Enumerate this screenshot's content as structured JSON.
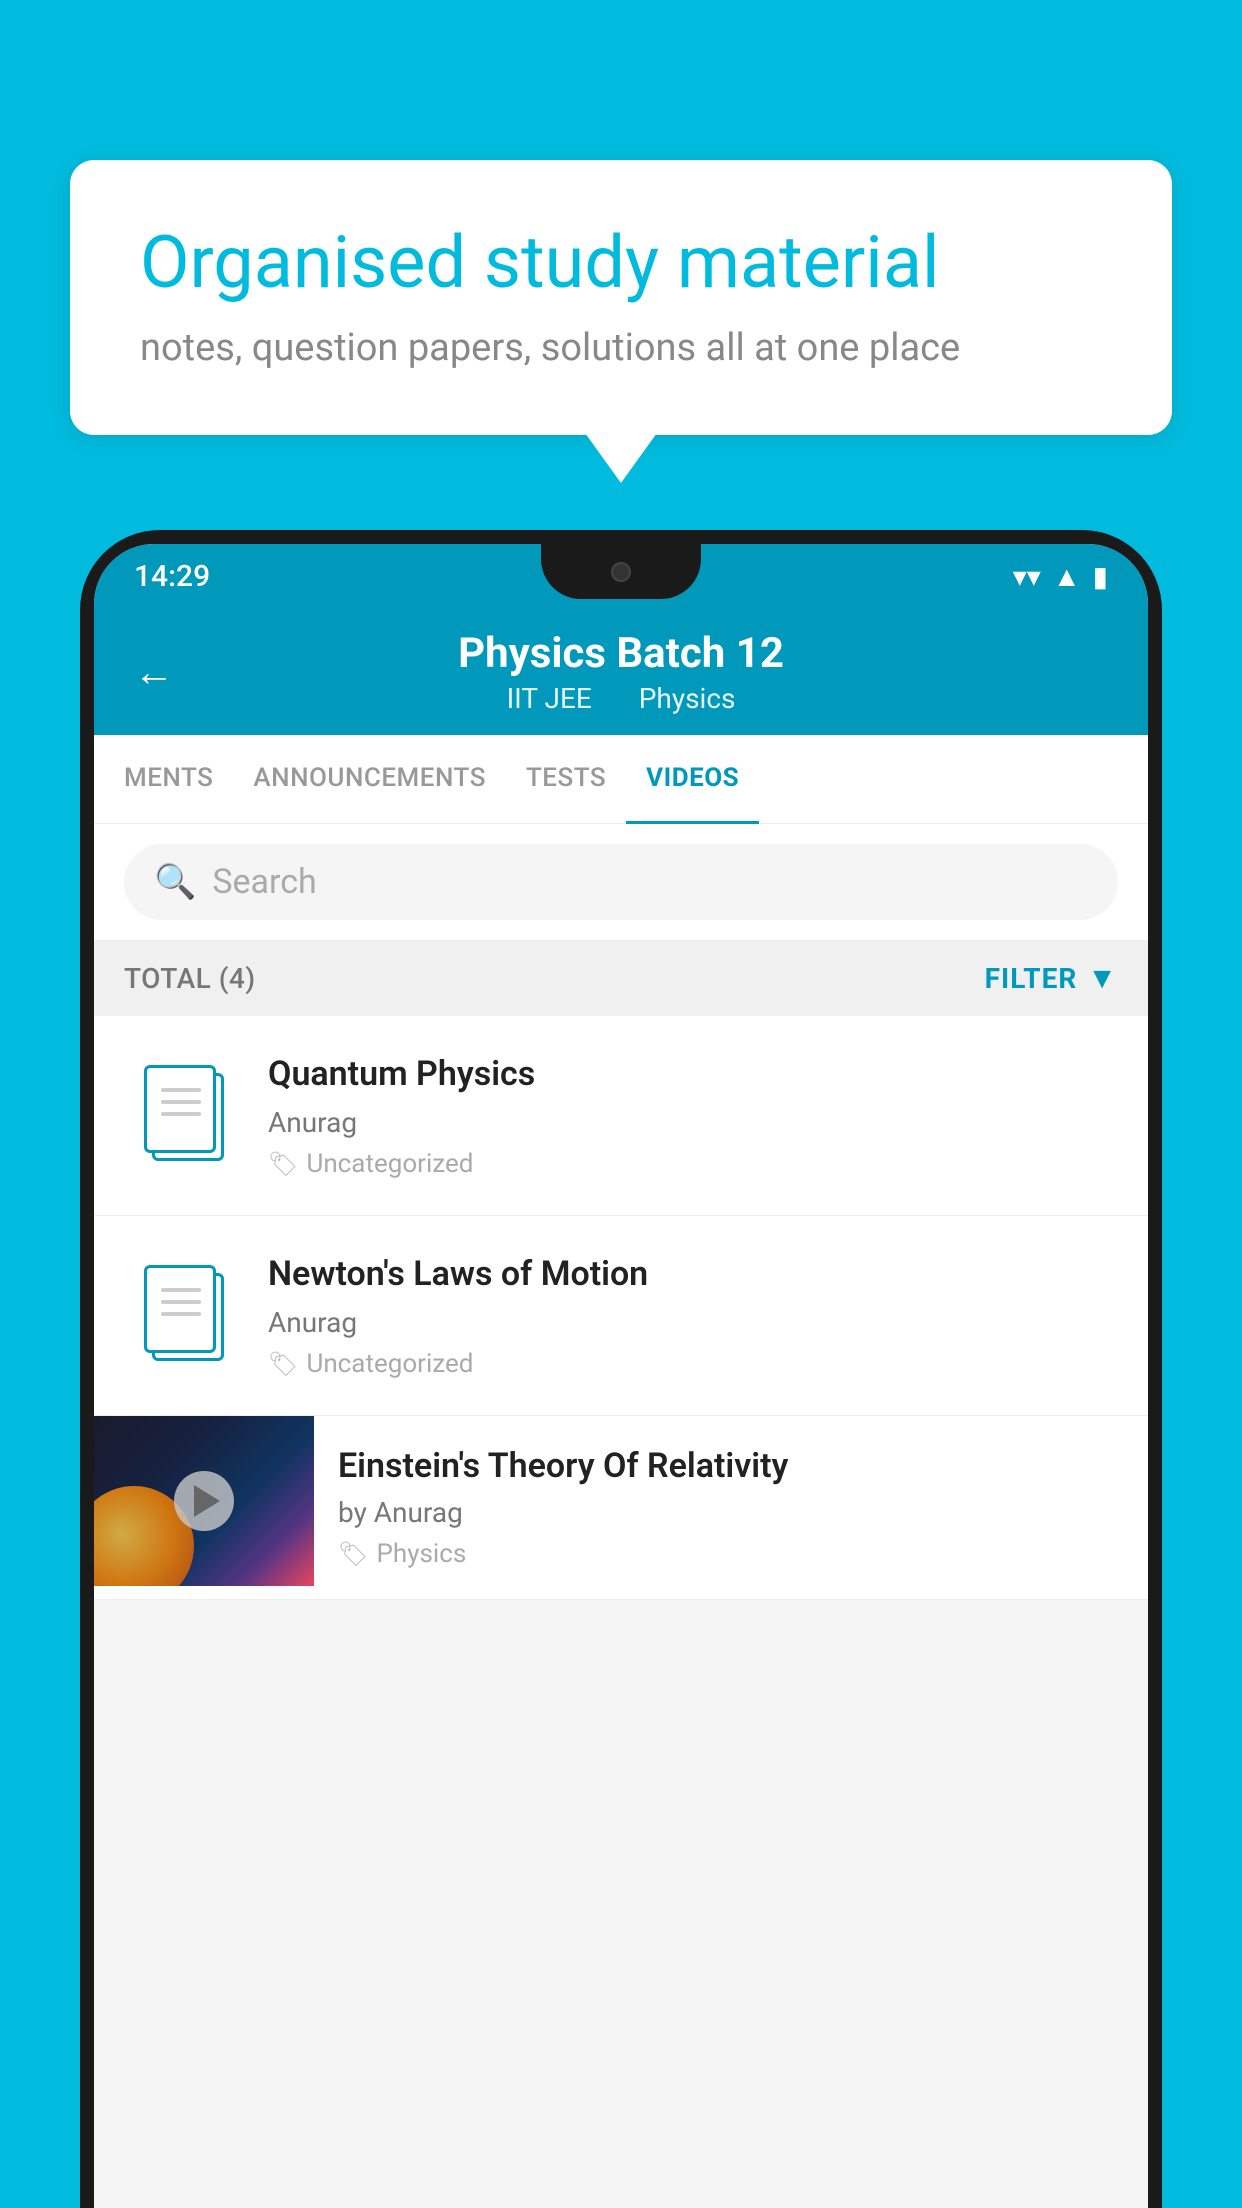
{
  "background_color": "#00BBDD",
  "speech_bubble": {
    "title": "Organised study material",
    "subtitle": "notes, question papers, solutions all at one place"
  },
  "phone": {
    "status_bar": {
      "time": "14:29",
      "icons": [
        "wifi",
        "signal",
        "battery"
      ]
    },
    "header": {
      "title": "Physics Batch 12",
      "subtitle_left": "IIT JEE",
      "subtitle_right": "Physics",
      "back_label": "←"
    },
    "tabs": [
      {
        "label": "MENTS",
        "active": false
      },
      {
        "label": "ANNOUNCEMENTS",
        "active": false
      },
      {
        "label": "TESTS",
        "active": false
      },
      {
        "label": "VIDEOS",
        "active": true
      }
    ],
    "search": {
      "placeholder": "Search"
    },
    "filter_row": {
      "total_label": "TOTAL (4)",
      "filter_label": "FILTER"
    },
    "videos": [
      {
        "id": 1,
        "title": "Quantum Physics",
        "author": "Anurag",
        "tag": "Uncategorized",
        "has_thumbnail": false
      },
      {
        "id": 2,
        "title": "Newton's Laws of Motion",
        "author": "Anurag",
        "tag": "Uncategorized",
        "has_thumbnail": false
      },
      {
        "id": 3,
        "title": "Einstein's Theory Of Relativity",
        "author": "by Anurag",
        "tag": "Physics",
        "has_thumbnail": true
      }
    ]
  }
}
